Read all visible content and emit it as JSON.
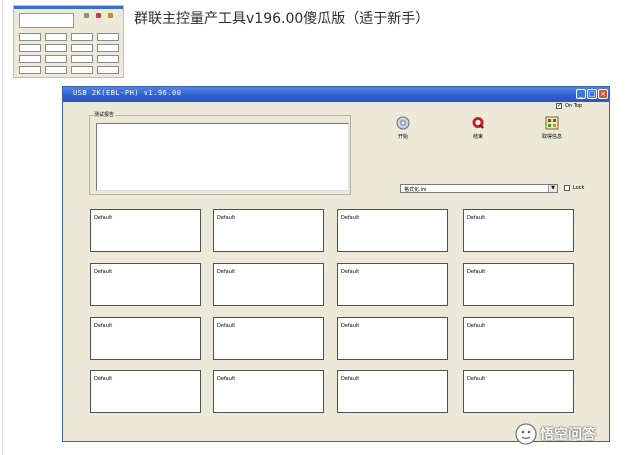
{
  "article": {
    "heading": "群联主控量产工具v196.00傻瓜版（适于新手）"
  },
  "window": {
    "title": "USB 2K(EBL-PH) v1.96.00",
    "controls": {
      "minimize": "_",
      "maximize": "□",
      "close": "×"
    },
    "on_top_label": "On Top",
    "on_top_checked": true,
    "test_report_label": "测试报告",
    "test_report_text": "",
    "toolbar": [
      {
        "id": "start",
        "label": "开始",
        "icon": "disc-icon"
      },
      {
        "id": "stop",
        "label": "结束",
        "icon": "stop-q-icon"
      },
      {
        "id": "get-info",
        "label": "取得信息",
        "icon": "info-grid-icon"
      }
    ],
    "config_select_value": "格式化.ini",
    "lock_label": "Lock",
    "lock_checked": false,
    "ports": [
      "Default",
      "Default",
      "Default",
      "Default",
      "Default",
      "Default",
      "Default",
      "Default",
      "Default",
      "Default",
      "Default",
      "Default",
      "Default",
      "Default",
      "Default",
      "Default"
    ]
  },
  "watermark": {
    "text": "悟空问答",
    "icon": "cartoon-face-icon"
  }
}
